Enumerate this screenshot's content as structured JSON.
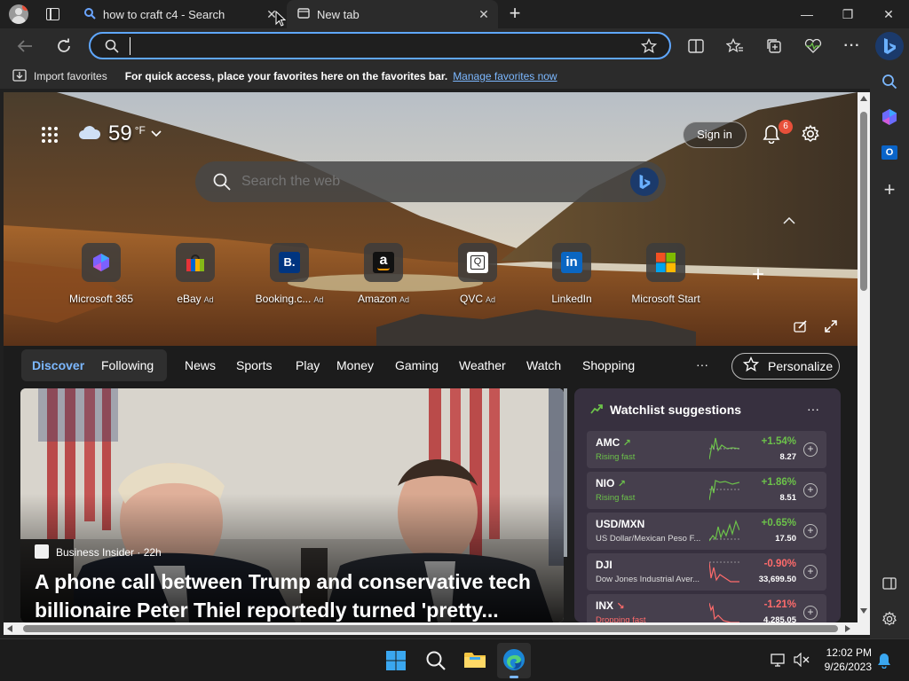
{
  "tabs": [
    {
      "title": "how to craft c4 - Search",
      "close": "✕"
    },
    {
      "title": "New tab",
      "close": "✕"
    }
  ],
  "new_tab_symbol": "+",
  "window": {
    "minimize": "—",
    "restore": "❐",
    "close": "✕"
  },
  "address_bar": {
    "value": "",
    "placeholder": ""
  },
  "favorites_bar": {
    "import_label": "Import favorites",
    "hint": "For quick access, place your favorites here on the favorites bar.",
    "manage_link": "Manage favorites now"
  },
  "weather": {
    "temp": "59",
    "unit": "°F",
    "icon": "cloud-icon"
  },
  "header": {
    "sign_in": "Sign in",
    "notification_count": "6"
  },
  "search": {
    "placeholder": "Search the web"
  },
  "quick_links": [
    {
      "label": "Microsoft 365",
      "ad": "",
      "glyph": "◆"
    },
    {
      "label": "eBay",
      "ad": "Ad",
      "glyph": "▦"
    },
    {
      "label": "Booking.c...",
      "ad": "Ad",
      "glyph": "B."
    },
    {
      "label": "Amazon",
      "ad": "Ad",
      "glyph": "a"
    },
    {
      "label": "QVC",
      "ad": "Ad",
      "glyph": "Q"
    },
    {
      "label": "LinkedIn",
      "ad": "",
      "glyph": "in"
    },
    {
      "label": "Microsoft Start",
      "ad": "",
      "glyph": "⊞"
    }
  ],
  "add_link": "+",
  "nav": {
    "tabs": [
      "Discover",
      "Following",
      "News",
      "Sports",
      "Play",
      "Money",
      "Gaming",
      "Weather",
      "Watch",
      "Shopping"
    ],
    "more": "···",
    "personalize": "Personalize"
  },
  "article": {
    "source": "Business Insider · 22h",
    "headline": "A phone call between Trump and conservative tech billionaire Peter Thiel reportedly turned 'pretty..."
  },
  "watchlist": {
    "title": "Watchlist suggestions",
    "more": "···",
    "items": [
      {
        "symbol": "AMC",
        "sub": "Rising fast",
        "change": "+1.54%",
        "price": "8.27",
        "trend": "up"
      },
      {
        "symbol": "NIO",
        "sub": "Rising fast",
        "change": "+1.86%",
        "price": "8.51",
        "trend": "up"
      },
      {
        "symbol": "USD/MXN",
        "sub": "US Dollar/Mexican Peso F...",
        "change": "+0.65%",
        "price": "17.50",
        "trend": "up"
      },
      {
        "symbol": "DJI",
        "sub": "Dow Jones Industrial Aver...",
        "change": "-0.90%",
        "price": "33,699.50",
        "trend": "down"
      },
      {
        "symbol": "INX",
        "sub": "Dropping fast",
        "change": "-1.21%",
        "price": "4,285.05",
        "trend": "down"
      }
    ]
  },
  "colors": {
    "accent": "#5fa7ff",
    "up": "#6cc24a",
    "down": "#ff6b6b",
    "badge": "#e8503a"
  },
  "clock": {
    "time": "12:02 PM",
    "date": "9/26/2023"
  }
}
